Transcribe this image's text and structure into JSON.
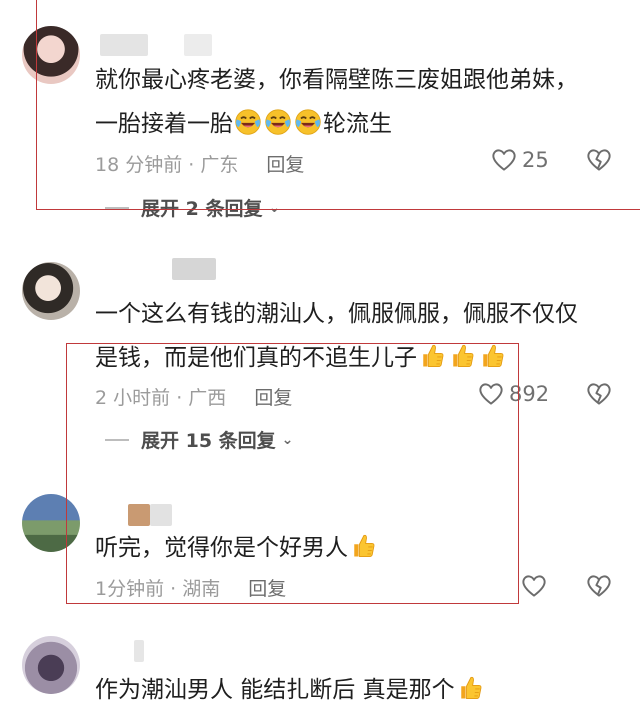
{
  "comments": [
    {
      "text_line1": "就你最心疼老婆，你看隔壁陈三废姐跟他弟妹，",
      "text_line2": "一胎接着一胎",
      "text_line2_tail": "轮流生",
      "emoji": "laughing-crying-emoji",
      "time": "18 分钟前",
      "location": "广东",
      "reply_label": "回复",
      "likes": "25",
      "expand_label": "展开 2 条回复"
    },
    {
      "text_line1": "一个这么有钱的潮汕人，佩服佩服，佩服不仅仅",
      "text_line2": "是钱，而是他们真的不追生儿子",
      "emoji": "thumbs-up-emoji",
      "time": "2 小时前",
      "location": "广西",
      "reply_label": "回复",
      "likes": "892",
      "expand_label": "展开 15 条回复"
    },
    {
      "text_line1": "听完，觉得你是个好男人",
      "emoji": "thumbs-up-emoji",
      "time": "1分钟前",
      "location": "湖南",
      "reply_label": "回复"
    },
    {
      "text_line1": "作为潮汕男人 能结扎断后 真是那个",
      "emoji": "thumbs-up-emoji"
    }
  ],
  "separator": "·",
  "colors": {
    "highlight_box": "#c0393b",
    "meta_text": "#9b9b9b",
    "body_text": "#1f1f1f"
  }
}
